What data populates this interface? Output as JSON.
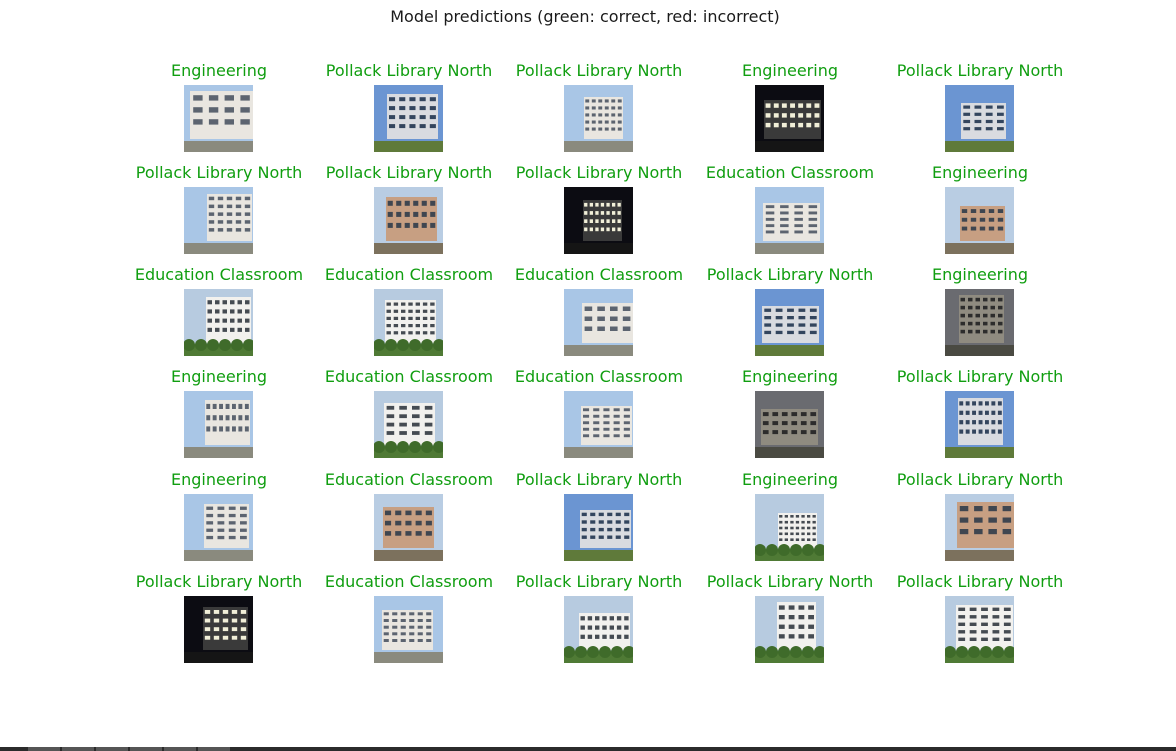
{
  "figure": {
    "title": "Model predictions (green: correct, red: incorrect)"
  },
  "colors": {
    "correct": "#109e10",
    "incorrect": "#d62728"
  },
  "predictions": [
    {
      "label": "Engineering",
      "correct": true,
      "scene": "white-building-day"
    },
    {
      "label": "Pollack Library North",
      "correct": true,
      "scene": "blue-glass-building-day"
    },
    {
      "label": "Pollack Library North",
      "correct": true,
      "scene": "tilted-wall-with-tree"
    },
    {
      "label": "Engineering",
      "correct": true,
      "scene": "building-night"
    },
    {
      "label": "Pollack Library North",
      "correct": true,
      "scene": "tall-building-sky"
    },
    {
      "label": "Pollack Library North",
      "correct": true,
      "scene": "dark-window-closeup"
    },
    {
      "label": "Pollack Library North",
      "correct": true,
      "scene": "tan-building-day"
    },
    {
      "label": "Pollack Library North",
      "correct": true,
      "scene": "building-night-lights"
    },
    {
      "label": "Education Classroom",
      "correct": true,
      "scene": "white-building-walkway"
    },
    {
      "label": "Engineering",
      "correct": true,
      "scene": "beige-building-day"
    },
    {
      "label": "Education Classroom",
      "correct": true,
      "scene": "white-building-plants"
    },
    {
      "label": "Education Classroom",
      "correct": true,
      "scene": "hedges-trees"
    },
    {
      "label": "Education Classroom",
      "correct": true,
      "scene": "white-wall-path"
    },
    {
      "label": "Pollack Library North",
      "correct": true,
      "scene": "blue-sky-building"
    },
    {
      "label": "Engineering",
      "correct": true,
      "scene": "gray-building-dusk"
    },
    {
      "label": "Engineering",
      "correct": true,
      "scene": "white-building-windows"
    },
    {
      "label": "Education Classroom",
      "correct": true,
      "scene": "white-building-shrubs"
    },
    {
      "label": "Education Classroom",
      "correct": true,
      "scene": "white-wall-walkway"
    },
    {
      "label": "Engineering",
      "correct": true,
      "scene": "building-evening"
    },
    {
      "label": "Pollack Library North",
      "correct": true,
      "scene": "angled-building-sky"
    },
    {
      "label": "Engineering",
      "correct": true,
      "scene": "angled-white-tower"
    },
    {
      "label": "Education Classroom",
      "correct": true,
      "scene": "distant-building-trees"
    },
    {
      "label": "Pollack Library North",
      "correct": true,
      "scene": "curved-glass-tower"
    },
    {
      "label": "Engineering",
      "correct": true,
      "scene": "white-building-lawn"
    },
    {
      "label": "Pollack Library North",
      "correct": true,
      "scene": "tan-curved-building"
    },
    {
      "label": "Pollack Library North",
      "correct": true,
      "scene": "building-night-street"
    },
    {
      "label": "Education Classroom",
      "correct": true,
      "scene": "white-tower-closeup"
    },
    {
      "label": "Pollack Library North",
      "correct": true,
      "scene": "glass-building-garden"
    },
    {
      "label": "Pollack Library North",
      "correct": true,
      "scene": "plaza-with-trees"
    },
    {
      "label": "Pollack Library North",
      "correct": true,
      "scene": "pine-trees-building"
    }
  ]
}
